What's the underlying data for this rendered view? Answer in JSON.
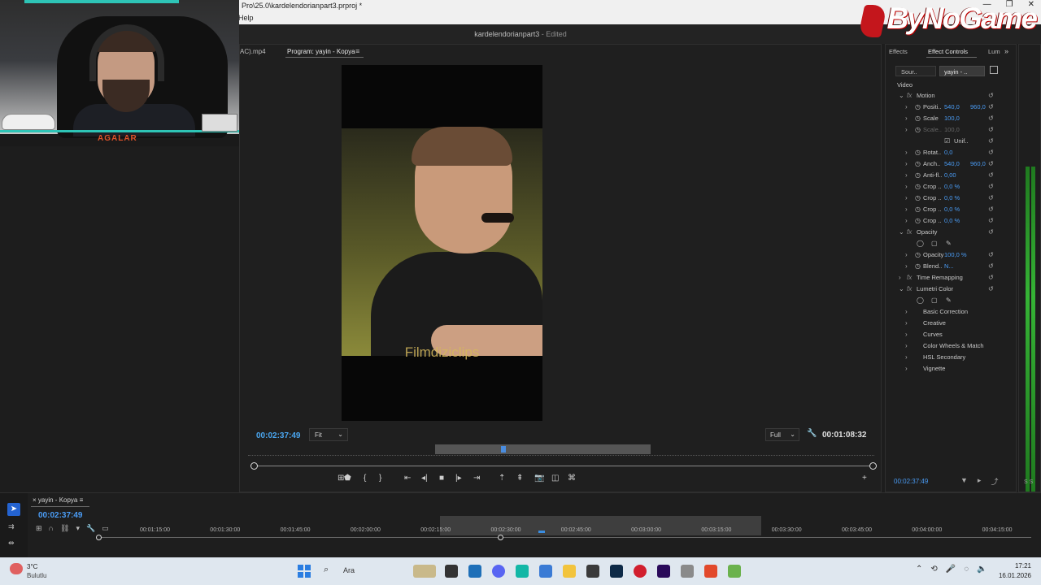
{
  "window": {
    "title": "Pro\\25.0\\kardelendorianpart3.prproj *",
    "menu_help": "Help",
    "doc_name": "kardelendorianpart3",
    "doc_status": "- Edited",
    "buttons": [
      "—",
      "❐",
      "✕"
    ]
  },
  "logo": {
    "text": "ByNoGame"
  },
  "webcam": {
    "label": "AGALAR"
  },
  "program_monitor": {
    "source_tab": "AC).mp4",
    "program_tab": "Program: yayin - Kopya",
    "watermark": "Filmdiziclips",
    "timecode": "00:02:37:49",
    "fit_label": "Fit",
    "resolution_label": "Full",
    "duration": "00:01:08:32"
  },
  "effect_controls": {
    "tabs": {
      "effects": "Effects",
      "effect_controls": "Effect Controls",
      "lumetri": "Lum"
    },
    "source_label": "Sour..",
    "sequence_label": "yayin - ..",
    "video_label": "Video",
    "rows": [
      {
        "kind": "section",
        "label": "Motion"
      },
      {
        "kind": "param",
        "label": "Positi..",
        "v1": "540,0",
        "v2": "960,0"
      },
      {
        "kind": "param",
        "label": "Scale",
        "v1": "100,0",
        "v2": ""
      },
      {
        "kind": "param-dim",
        "label": "Scale..",
        "v1": "100,0",
        "v2": ""
      },
      {
        "kind": "check",
        "label": "Unif.."
      },
      {
        "kind": "param",
        "label": "Rotat..",
        "v1": "0,0",
        "v2": ""
      },
      {
        "kind": "param",
        "label": "Anch..",
        "v1": "540,0",
        "v2": "960,0"
      },
      {
        "kind": "param",
        "label": "Anti-fl..",
        "v1": "0,00",
        "v2": ""
      },
      {
        "kind": "param",
        "label": "Crop ..",
        "v1": "0,0 %",
        "v2": ""
      },
      {
        "kind": "param",
        "label": "Crop ..",
        "v1": "0,0 %",
        "v2": ""
      },
      {
        "kind": "param",
        "label": "Crop ..",
        "v1": "0,0 %",
        "v2": ""
      },
      {
        "kind": "param",
        "label": "Crop ..",
        "v1": "0,0 %",
        "v2": ""
      },
      {
        "kind": "section",
        "label": "Opacity"
      },
      {
        "kind": "icons",
        "label": ""
      },
      {
        "kind": "param",
        "label": "Opacity",
        "v1": "100,0 %",
        "v2": ""
      },
      {
        "kind": "param-sel",
        "label": "Blend..",
        "v1": "N...",
        "v2": ""
      },
      {
        "kind": "section-closed",
        "label": "Time Remapping"
      },
      {
        "kind": "section",
        "label": "Lumetri Color"
      },
      {
        "kind": "icons",
        "label": ""
      },
      {
        "kind": "sub",
        "label": "Basic Correction"
      },
      {
        "kind": "sub",
        "label": "Creative"
      },
      {
        "kind": "sub",
        "label": "Curves"
      },
      {
        "kind": "sub",
        "label": "Color Wheels & Match"
      },
      {
        "kind": "sub",
        "label": "HSL Secondary"
      },
      {
        "kind": "sub",
        "label": "Vignette"
      }
    ],
    "timecode": "00:02:37:49"
  },
  "meter": {
    "label": "S S"
  },
  "timeline": {
    "sequence_tab": "yayin - Kopya",
    "timecode": "00:02:37:49",
    "ticks": [
      "00:01:15:00",
      "00:01:30:00",
      "00:01:45:00",
      "00:02:00:00",
      "00:02:15:00",
      "00:02:30:00",
      "00:02:45:00",
      "00:03:00:00",
      "00:03:15:00",
      "00:03:30:00",
      "00:03:45:00",
      "00:04:00:00",
      "00:04:15:00"
    ]
  },
  "taskbar": {
    "temperature": "3°C",
    "weather": "Bulutlu",
    "search_placeholder": "Ara",
    "time": "17:21",
    "date": "16.01.2026"
  }
}
